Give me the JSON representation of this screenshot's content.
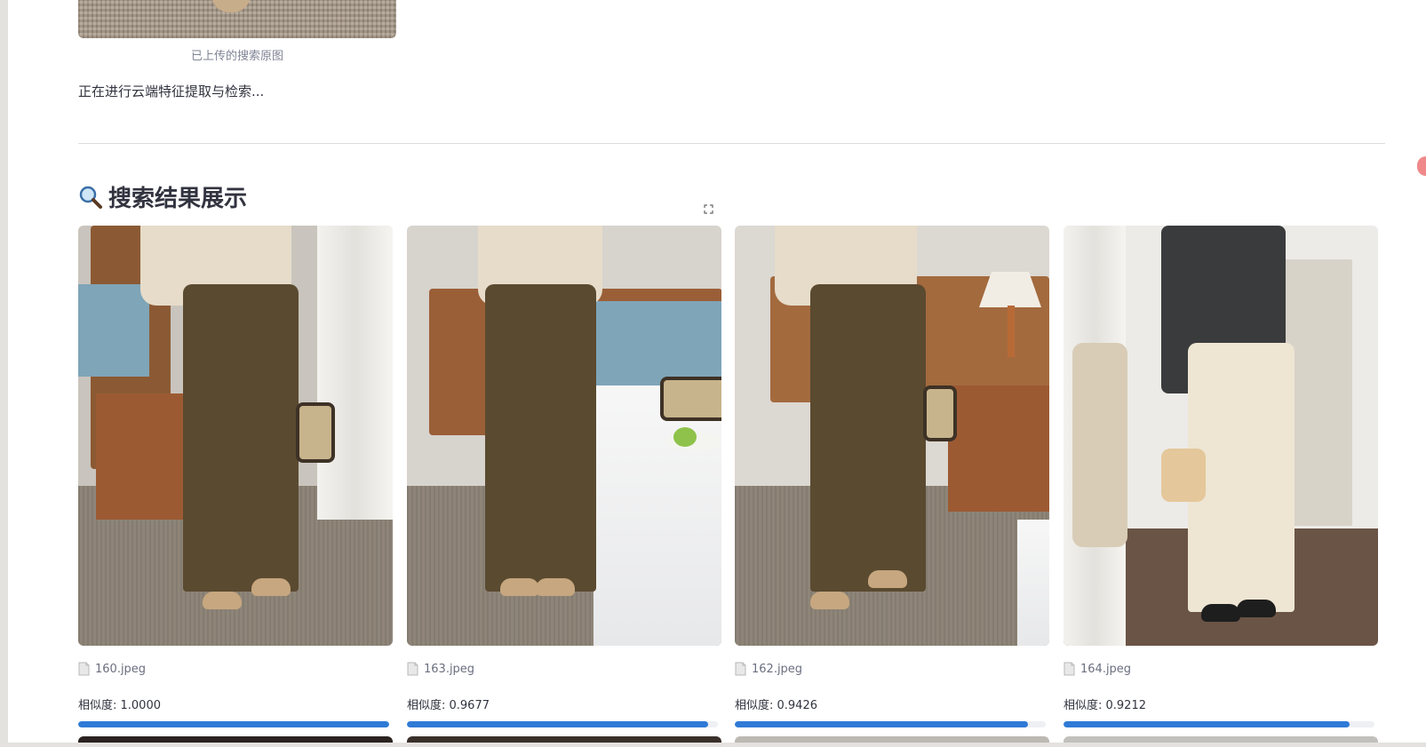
{
  "upload": {
    "caption": "已上传的搜索原图",
    "status": "正在进行云端特征提取与检索..."
  },
  "results": {
    "title": "搜索结果展示",
    "title_icon": "magnifier-icon",
    "fullscreen_icon": "fullscreen-icon",
    "items": [
      {
        "filename": "160.jpeg",
        "similarity_label": "相似度: 1.0000",
        "similarity": 1.0,
        "scene": "corduroy-brown"
      },
      {
        "filename": "163.jpeg",
        "similarity_label": "相似度: 0.9677",
        "similarity": 0.9677,
        "scene": "corduroy-brown-bed"
      },
      {
        "filename": "162.jpeg",
        "similarity_label": "相似度: 0.9426",
        "similarity": 0.9426,
        "scene": "corduroy-brown-lamp"
      },
      {
        "filename": "164.jpeg",
        "similarity_label": "相似度: 0.9212",
        "similarity": 0.9212,
        "scene": "cream-pants-black-cardigan"
      }
    ]
  },
  "colors": {
    "progress": "#2f7ad6",
    "track": "#eef0f4",
    "text": "#31333f",
    "muted": "#808495"
  }
}
